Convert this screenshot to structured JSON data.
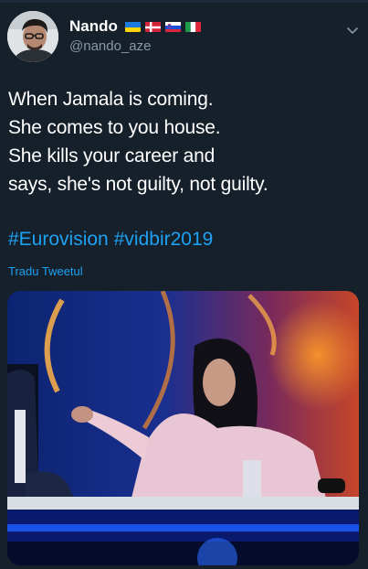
{
  "author": {
    "display_name": "Nando",
    "handle": "@nando_aze",
    "flags": [
      "ukraine-flag",
      "denmark-flag",
      "slovenia-flag",
      "italy-flag"
    ]
  },
  "tweet": {
    "lines": [
      "When Jamala is coming.",
      "She comes to you house.",
      "She kills your career and",
      "says, she's not guilty, not guilty."
    ],
    "hashtags": [
      "#Eurovision",
      "#vidbir2019"
    ],
    "translate_label": "Tradu Tweetul"
  },
  "colors": {
    "background": "#15202b",
    "link": "#1da1f2",
    "secondary_text": "#8899a6"
  }
}
